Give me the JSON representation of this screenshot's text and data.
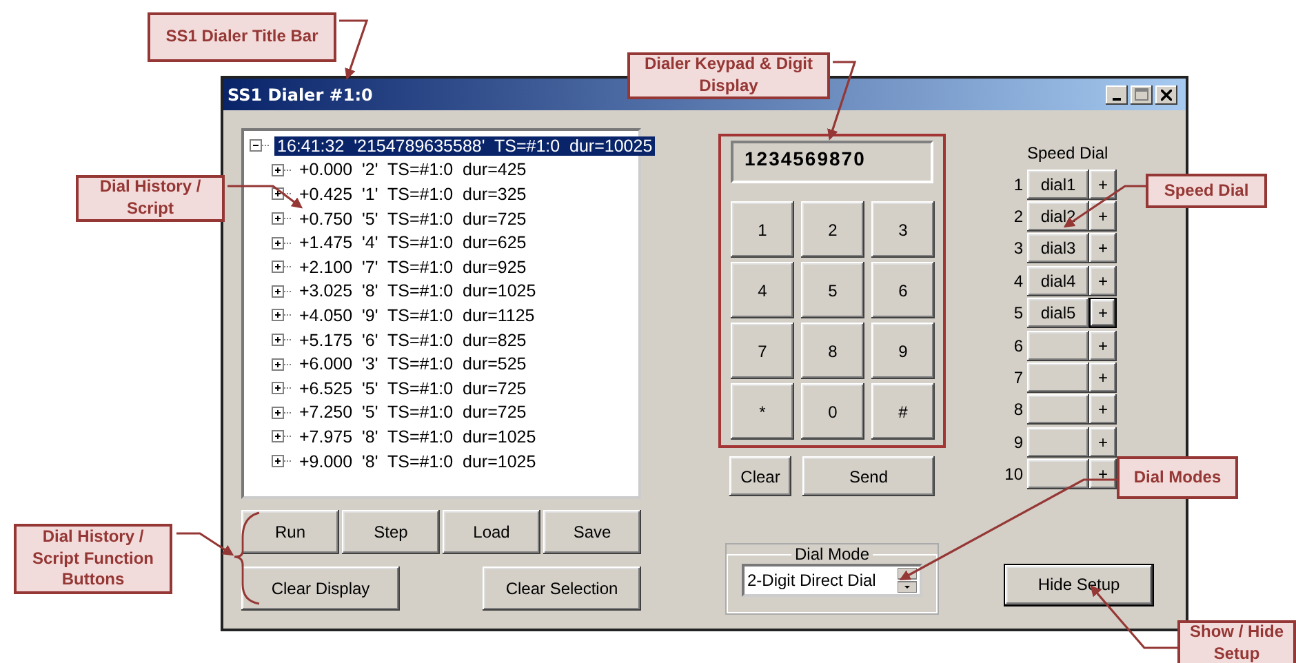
{
  "window": {
    "title": "SS1 Dialer #1:0"
  },
  "history_tree": {
    "root": {
      "text": "16:41:32  '2154789635588'  TS=#1:0  dur=10025",
      "expanded": true,
      "selected": true,
      "children": [
        {
          "text": "+0.000  '2'  TS=#1:0  dur=425",
          "expanded": false,
          "selected": false
        },
        {
          "text": "+0.425  '1'  TS=#1:0  dur=325",
          "expanded": false,
          "selected": false
        },
        {
          "text": "+0.750  '5'  TS=#1:0  dur=725",
          "expanded": false,
          "selected": false
        },
        {
          "text": "+1.475  '4'  TS=#1:0  dur=625",
          "expanded": false,
          "selected": false
        },
        {
          "text": "+2.100  '7'  TS=#1:0  dur=925",
          "expanded": false,
          "selected": false
        },
        {
          "text": "+3.025  '8'  TS=#1:0  dur=1025",
          "expanded": false,
          "selected": false
        },
        {
          "text": "+4.050  '9'  TS=#1:0  dur=1125",
          "expanded": false,
          "selected": false
        },
        {
          "text": "+5.175  '6'  TS=#1:0  dur=825",
          "expanded": false,
          "selected": false
        },
        {
          "text": "+6.000  '3'  TS=#1:0  dur=525",
          "expanded": false,
          "selected": false
        },
        {
          "text": "+6.525  '5'  TS=#1:0  dur=725",
          "expanded": false,
          "selected": false
        },
        {
          "text": "+7.250  '5'  TS=#1:0  dur=725",
          "expanded": false,
          "selected": false
        },
        {
          "text": "+7.975  '8'  TS=#1:0  dur=1025",
          "expanded": false,
          "selected": false
        },
        {
          "text": "+9.000  '8'  TS=#1:0  dur=1025",
          "expanded": false,
          "selected": false
        }
      ]
    }
  },
  "script_buttons": [
    "Run",
    "Step",
    "Load",
    "Save"
  ],
  "display_buttons": [
    "Clear Display",
    "Clear Selection"
  ],
  "keypad": {
    "display": "1234569870",
    "keys": [
      "1",
      "2",
      "3",
      "4",
      "5",
      "6",
      "7",
      "8",
      "9",
      "*",
      "0",
      "#"
    ],
    "clear": "Clear",
    "send": "Send"
  },
  "dial_mode": {
    "label": "Dial Mode",
    "value": "2-Digit Direct Dial"
  },
  "speed_dial": {
    "title": "Speed Dial",
    "entries": [
      {
        "number": "1",
        "label": "dial1",
        "add": "+",
        "focused": false
      },
      {
        "number": "2",
        "label": "dial2",
        "add": "+",
        "focused": false
      },
      {
        "number": "3",
        "label": "dial3",
        "add": "+",
        "focused": false
      },
      {
        "number": "4",
        "label": "dial4",
        "add": "+",
        "focused": false
      },
      {
        "number": "5",
        "label": "dial5",
        "add": "+",
        "focused": true
      },
      {
        "number": "6",
        "add": "+",
        "focused": false
      },
      {
        "number": "7",
        "add": "+",
        "focused": false
      },
      {
        "number": "8",
        "add": "+",
        "focused": false
      },
      {
        "number": "9",
        "add": "+",
        "focused": false
      },
      {
        "number": "10",
        "add": "+",
        "focused": false
      }
    ]
  },
  "hide_setup": "Hide Setup",
  "callouts": [
    {
      "kind": "title",
      "text": "SS1 Dialer Title Bar"
    },
    {
      "kind": "keypad",
      "text": "Dialer Keypad & Digit Display"
    },
    {
      "kind": "history",
      "text": "Dial History / Script"
    },
    {
      "kind": "speed",
      "text": "Speed Dial"
    },
    {
      "kind": "modes",
      "text": "Dial Modes"
    },
    {
      "kind": "functions",
      "text": "Dial History / Script Function Buttons"
    },
    {
      "kind": "setup",
      "text": "Show / Hide Setup"
    }
  ]
}
